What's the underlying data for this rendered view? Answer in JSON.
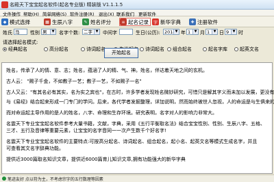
{
  "window": {
    "title": "名殿天下宝宝起名软件(起名专业版) 精装版 V1.1.1.5"
  },
  "menu": [
    "文件操作",
    "帮助(H)",
    "简单网络(S)",
    "软件注册(R)",
    "退出(X)",
    "联系我们",
    "更新软件"
  ],
  "toolbar": [
    {
      "label": "模式选择",
      "color": "#2e6fc2",
      "active": false
    },
    {
      "label": "生辰八字",
      "color": "#c0392b",
      "active": false
    },
    {
      "label": "姓名评分",
      "color": "#2f8f46",
      "active": false
    },
    {
      "label": "起名记录",
      "color": "#c0392b",
      "active": true
    },
    {
      "label": "新华字典",
      "color": "#d9342b",
      "active": false
    },
    {
      "label": "注册软件",
      "color": "#3a6fb7",
      "active": false
    }
  ],
  "params": {
    "surname_label": "姓氏",
    "surname_value": "马",
    "gender_label": "性别",
    "gender_value": "男",
    "name_length_label": "名字个数:",
    "name_length_value": "二字",
    "middle_char_label": "中间字",
    "middle_char_value": "",
    "birthday_label": "生日(公历):",
    "year_value": "2014",
    "year_unit": "年",
    "month_value": "1",
    "month_unit": "月",
    "day_value": "1",
    "day_unit": "日",
    "hour_value": "9",
    "hour_unit": "时"
  },
  "mode": {
    "label": "请选择起名模式:",
    "options": [
      {
        "label": "经典起名",
        "selected": true
      },
      {
        "label": "高分起名",
        "selected": false
      },
      {
        "label": "诗词起名",
        "selected": false
      },
      {
        "label": "生肖起名",
        "selected": false
      },
      {
        "label": "诗词起名",
        "selected": false
      },
      {
        "label": "组合起名",
        "selected": false
      },
      {
        "label": "起名字库",
        "selected": false
      },
      {
        "label": "起英文名",
        "selected": false
      }
    ]
  },
  "start_button": "开始起名",
  "content": [
    "姓名，传承了人的情、意、志；姓名，蕴涵了人的精、气、神。姓名，伴达着天地之间的玄机。",
    "古人云：   \"赐子千金，不如教子一艺；教子一艺，不如赐子一名\"",
    "古人又云：\"有其名必有其实，名为实之宾也\"，在古时，许多学者发现姓名微妙研究，可惜只是解其字义而未加以发展，更没有",
    "与《易经》结合起来形成一门专门的学问。后来，各代学者发掘整理，详加说明，然而始终被世人忽视，人的命运是与生俱来的。",
    "而对命运起主导作用的是人的姓名，八字、命理和生存环境。研究表明，名字对人的影响力非常大。",
    "名震天下专业宝宝起名软件参考大量书籍，文献，字典，采用《五行平衡取名法》结合宝宝性别、性别、生辰八字、五格、",
    "三才、五行及音律等重要元素，让宝宝的名字音同一一次产生数千个好名字!",
    "名震天下专业宝宝起名软件的主要特点:可按高分起名、诗词起名、组合起名，起小名、起英文名等模式生成名字，并且",
    "可查看其文名字辞典功能。",
    "提供近3000篇取名知识文章，提供近6000篇育儿知识文章,拥有功能强大的新华字典"
  ],
  "status": "笔迹友好 点以符为主，不考虑宗字的五行数理等因素"
}
